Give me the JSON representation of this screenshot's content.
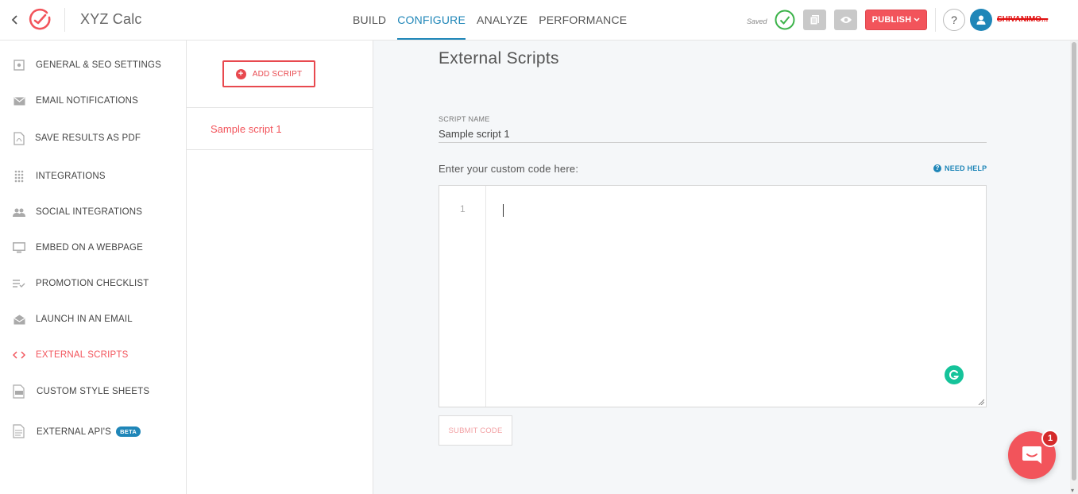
{
  "header": {
    "app_title": "XYZ Calc",
    "nav": [
      "BUILD",
      "CONFIGURE",
      "ANALYZE",
      "PERFORMANCE"
    ],
    "active_nav": "CONFIGURE",
    "saved_text": "Saved",
    "publish_label": "PUBLISH",
    "help_label": "?",
    "username": "SHIVANIMO..."
  },
  "sidebar": {
    "items": [
      {
        "label": "GENERAL & SEO SETTINGS",
        "icon": "settings-icon"
      },
      {
        "label": "EMAIL NOTIFICATIONS",
        "icon": "envelope-icon"
      },
      {
        "label": "SAVE RESULTS AS PDF",
        "icon": "pdf-icon"
      },
      {
        "label": "INTEGRATIONS",
        "icon": "grid-dots-icon"
      },
      {
        "label": "SOCIAL INTEGRATIONS",
        "icon": "people-icon"
      },
      {
        "label": "EMBED ON A WEBPAGE",
        "icon": "monitor-icon"
      },
      {
        "label": "PROMOTION CHECKLIST",
        "icon": "checklist-icon"
      },
      {
        "label": "LAUNCH IN AN EMAIL",
        "icon": "open-envelope-icon"
      },
      {
        "label": "EXTERNAL SCRIPTS",
        "icon": "code-icon"
      },
      {
        "label": "CUSTOM STYLE SHEETS",
        "icon": "css-file-icon"
      },
      {
        "label": "EXTERNAL API'S",
        "icon": "api-file-icon",
        "badge": "BETA"
      }
    ],
    "active": "EXTERNAL SCRIPTS"
  },
  "scripts_panel": {
    "add_label": "ADD SCRIPT",
    "scripts": [
      "Sample script 1"
    ]
  },
  "main": {
    "title": "External Scripts",
    "field_label": "SCRIPT NAME",
    "field_value": "Sample script 1",
    "code_label": "Enter your custom code here:",
    "need_help": "NEED HELP",
    "line_number": "1",
    "submit_label": "SUBMIT CODE"
  },
  "chat": {
    "badge_count": "1"
  },
  "colors": {
    "accent_red": "#f2545b",
    "accent_blue": "#1f86b8",
    "grammarly_green": "#15c39a"
  }
}
